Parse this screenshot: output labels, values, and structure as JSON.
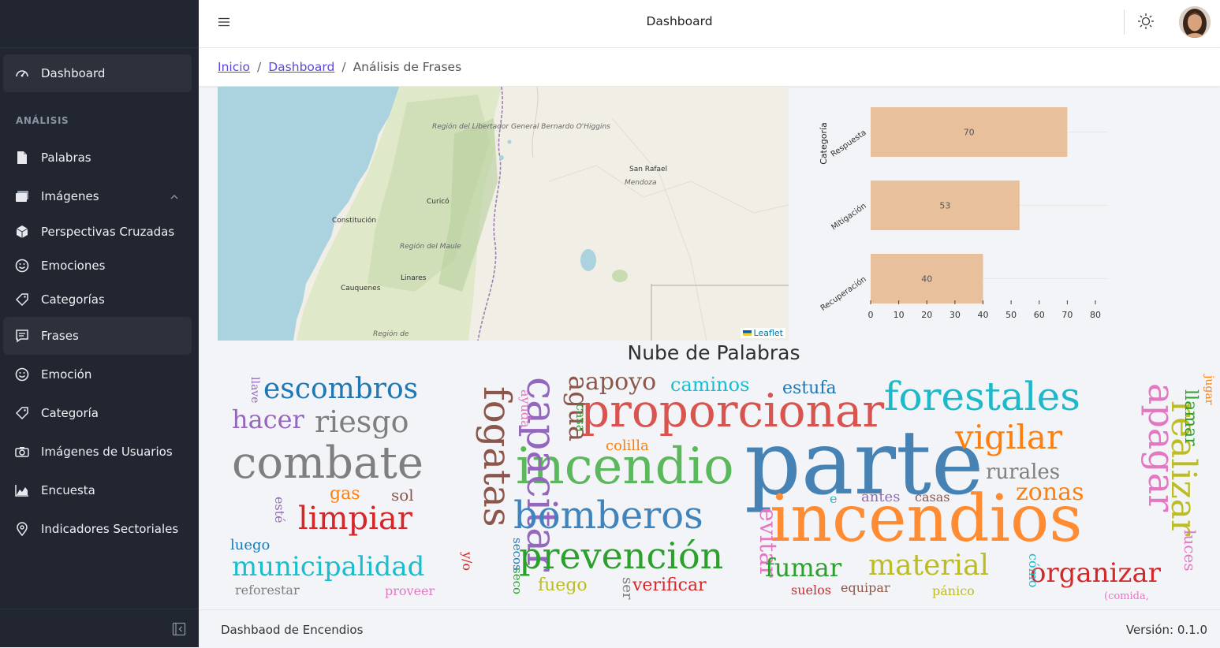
{
  "header": {
    "title": "Dashboard"
  },
  "sidebar": {
    "section_label": "ANÁLISIS",
    "items": [
      {
        "label": "Dashboard",
        "icon": "speedometer-icon"
      },
      {
        "label": "Palabras",
        "icon": "file-icon"
      },
      {
        "label": "Imágenes",
        "icon": "images-icon"
      },
      {
        "label": "Perspectivas Cruzadas",
        "icon": "cube-icon"
      },
      {
        "label": "Emociones",
        "icon": "smile-icon"
      },
      {
        "label": "Categorías",
        "icon": "tag-icon"
      },
      {
        "label": "Frases",
        "icon": "chat-icon"
      },
      {
        "label": "Emoción",
        "icon": "smile-icon"
      },
      {
        "label": "Categoría",
        "icon": "tag-icon"
      },
      {
        "label": "Imágenes de Usuarios",
        "icon": "camera-icon"
      },
      {
        "label": "Encuesta",
        "icon": "area-chart-icon"
      },
      {
        "label": "Indicadores Sectoriales",
        "icon": "location-pin-icon"
      }
    ]
  },
  "breadcrumb": {
    "home": "Inicio",
    "parent": "Dashboard",
    "current": "Análisis de Frases"
  },
  "map": {
    "places": [
      "San Rafael",
      "Curicó",
      "Constitución",
      "Linares",
      "Cauquenes"
    ],
    "regions": [
      "Región del Libertador General Bernardo O'Higgins",
      "Mendoza",
      "Región del Maule",
      "Región de"
    ],
    "attribution": "Leaflet"
  },
  "chart_data": {
    "type": "bar",
    "orientation": "horizontal",
    "ylabel": "Categoría",
    "categories": [
      "Respuesta",
      "Mitigación",
      "Recuperación"
    ],
    "values": [
      70,
      53,
      40
    ],
    "xlim": [
      0,
      80
    ],
    "xticks": [
      0,
      10,
      20,
      30,
      40,
      50,
      60,
      70,
      80
    ],
    "bar_color": "#e8c09c"
  },
  "wordcloud": {
    "title": "Nube de Palabras",
    "words": [
      "parte",
      "incendios",
      "incendio",
      "proporcionar",
      "forestales",
      "combate",
      "capacitar",
      "fogatas",
      "bomberos",
      "prevención",
      "apagar",
      "realizar",
      "vigilar",
      "limpiar",
      "escombros",
      "municipalidad",
      "material",
      "organizar",
      "riesgo",
      "hacer",
      "agua",
      "evitar",
      "basura",
      "fumar",
      "apoyo",
      "zonas",
      "caminos",
      "rurales",
      "estufa",
      "llamar",
      "verificar",
      "luces",
      "focos",
      "fuego",
      "gas",
      "sol",
      "colilla",
      "antes",
      "casas",
      "suelos",
      "equipar",
      "pánico",
      "luego",
      "reforestar",
      "proveer",
      "ayuda",
      "casa",
      "llave",
      "esté",
      "y/o",
      "secos",
      "seco",
      "ser",
      "e",
      "cómo",
      "jugar",
      "(comida,"
    ]
  },
  "footer": {
    "left": "Dashbaod de Encendios",
    "right": "Versión: 0.1.0"
  }
}
